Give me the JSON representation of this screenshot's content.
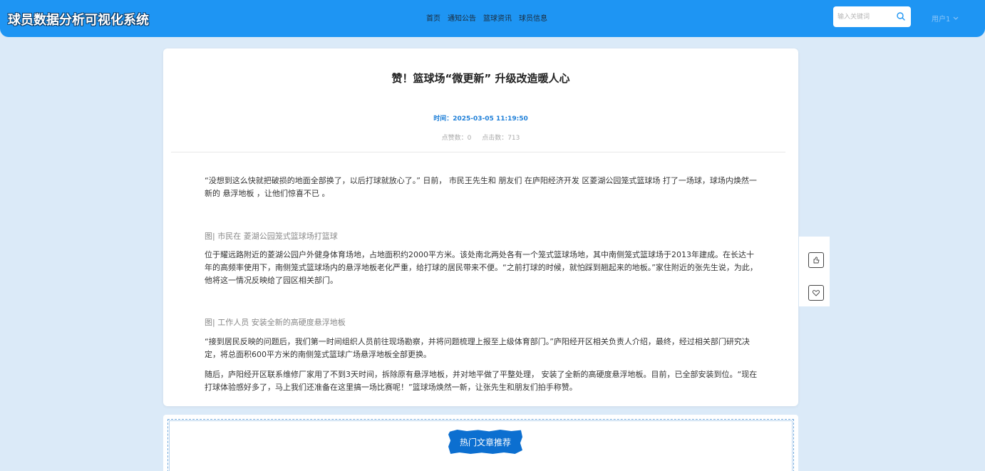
{
  "header": {
    "logo": "球员数据分析可视化系统",
    "nav": [
      "首页",
      "通知公告",
      "篮球资讯",
      "球员信息"
    ],
    "search_placeholder": "输入关键词",
    "user": "用户1"
  },
  "article": {
    "title": "赞！篮球场“微更新” 升级改造暖人心",
    "time": "时间：2025-03-05 11:19:50",
    "likes": "点赞数：0",
    "clicks": "点击数：713",
    "p1": "“没想到这么快就把破损的地面全部换了，以后打球就放心了。” 日前， 市民王先生和 朋友们 在庐阳经济开发 区菱湖公园笼式篮球场 打了一场球，球场内焕然一新的 悬浮地板 ，让他们惊喜不已 。",
    "caption1": "图| 市民在 菱湖公园笼式篮球场打篮球",
    "p2": "位于耀远路附近的菱湖公园户外健身体育场地，占地面积约2000平方米。该处南北两处各有一个笼式篮球场地，其中南侧笼式篮球场于2013年建成。在长达十年的高频率使用下，南侧笼式篮球场内的悬浮地板老化严重，给打球的居民带来不便。“之前打球的时候，就怕踩到翘起来的地板。”家住附近的张先生说，为此，他将这一情况反映给了园区相关部门。",
    "caption2": "图| 工作人员 安装全新的高硬度悬浮地板",
    "p3": "“接到居民反映的问题后，我们第一时间组织人员前往现场勘察，并将问题梳理上报至上级体育部门。”庐阳经开区相关负责人介绍，最终，经过相关部门研究决定，将总面积600平方米的南侧笼式篮球广场悬浮地板全部更换。",
    "p4": "随后，庐阳经开区联系维修厂家用了不到3天时间，拆除原有悬浮地板，并对地平做了平整处理， 安装了全新的高硬度悬浮地板。目前，已全部安装到位。“现在打球体验感好多了，马上我们还准备在这里搞一场比赛呢！”篮球场焕然一新，让张先生和朋友们拍手称赞。"
  },
  "recommend": {
    "title": "热门文章推荐"
  },
  "icons": {
    "search": "search-icon",
    "like": "thumb-up-icon",
    "favorite": "heart-icon",
    "dropdown": "chevron-down-icon"
  },
  "colors": {
    "header_bg": "#1e95f3",
    "page_bg": "#dbeaf8",
    "accent": "#1e7fd8",
    "badge_bg": "#0c6fd0"
  }
}
